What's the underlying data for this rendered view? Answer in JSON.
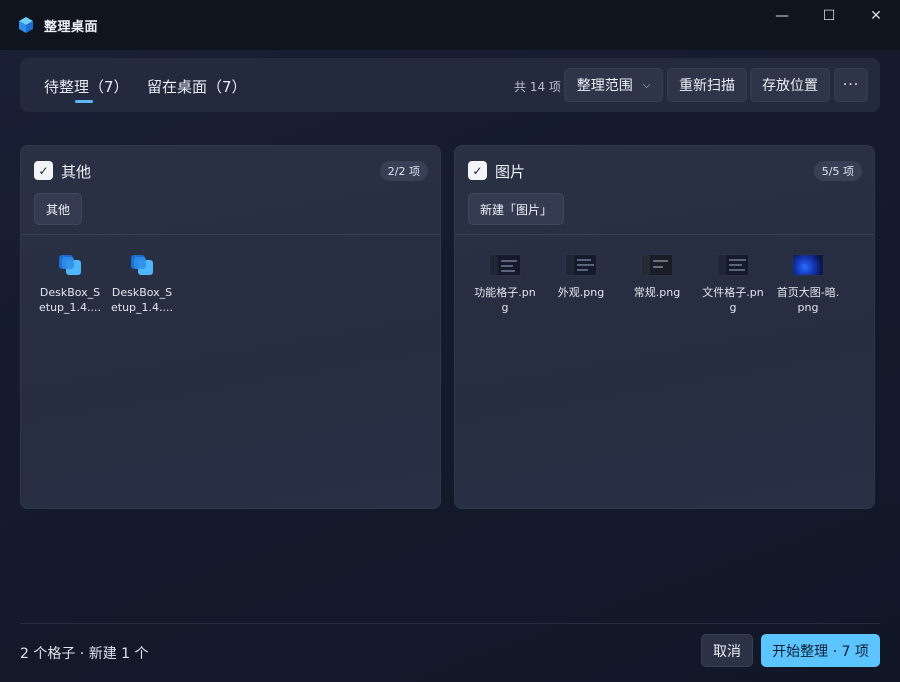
{
  "window": {
    "title": "整理桌面",
    "minimize_glyph": "—",
    "maximize_glyph": "☐",
    "close_glyph": "✕"
  },
  "toolbar": {
    "tabs": [
      {
        "label": "待整理（7）",
        "active": true
      },
      {
        "label": "留在桌面（7）",
        "active": false
      }
    ],
    "total_count": "共 14 项",
    "scope_label": "整理范围",
    "rescan_label": "重新扫描",
    "location_label": "存放位置",
    "more_label": "···"
  },
  "groups": [
    {
      "title": "其他",
      "checked": true,
      "badge": "2/2 项",
      "chip": "其他",
      "files": [
        {
          "name": "DeskBox_Setup_1.4....",
          "icon": "deskbox-installer-icon"
        },
        {
          "name": "DeskBox_Setup_1.4....",
          "icon": "deskbox-installer-icon"
        }
      ]
    },
    {
      "title": "图片",
      "checked": true,
      "badge": "5/5 项",
      "chip": "新建「图片」",
      "files": [
        {
          "name": "功能格子.png",
          "icon": "screenshot-thumbnail"
        },
        {
          "name": "外观.png",
          "icon": "screenshot-thumbnail"
        },
        {
          "name": "常规.png",
          "icon": "screenshot-thumbnail"
        },
        {
          "name": "文件格子.png",
          "icon": "screenshot-thumbnail"
        },
        {
          "name": "首页大图-暗.png",
          "icon": "hero-image-thumbnail"
        }
      ]
    }
  ],
  "footer": {
    "summary": "2 个格子 · 新建 1 个",
    "cancel_label": "取消",
    "start_label": "开始整理 · 7 项"
  },
  "colors": {
    "accent": "#5cc4ff",
    "background": "#151a2c",
    "panel": "#282f42",
    "titlebar": "#10141f"
  }
}
